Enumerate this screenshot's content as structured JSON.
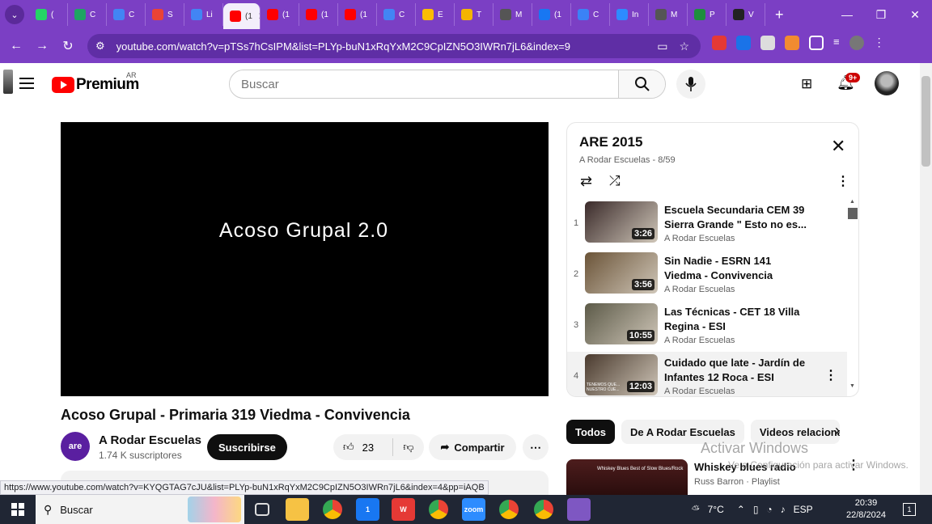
{
  "browser": {
    "tabs": [
      {
        "label": "(",
        "color": "#25d366"
      },
      {
        "label": "C",
        "color": "#1fa463"
      },
      {
        "label": "C",
        "color": "#4285f4"
      },
      {
        "label": "S",
        "color": "#ea4335"
      },
      {
        "label": "Li",
        "color": "#4285f4"
      },
      {
        "label": "(1",
        "color": "#ff0000",
        "active": true
      },
      {
        "label": "(1",
        "color": "#ff0000"
      },
      {
        "label": "(1",
        "color": "#ff0000"
      },
      {
        "label": "(1",
        "color": "#ff0000"
      },
      {
        "label": "C",
        "color": "#4285f4"
      },
      {
        "label": "E",
        "color": "#fbbc04"
      },
      {
        "label": "T",
        "color": "#f4b400"
      },
      {
        "label": "M",
        "color": "#555555"
      },
      {
        "label": "(1",
        "color": "#1877f2"
      },
      {
        "label": "C",
        "color": "#3b82f6"
      },
      {
        "label": "In",
        "color": "#2d8cff"
      },
      {
        "label": "M",
        "color": "#555555"
      },
      {
        "label": "P",
        "color": "#1e8e3e"
      },
      {
        "label": "V",
        "color": "#222222"
      }
    ],
    "url": "youtube.com/watch?v=pTSs7hCsIPM&list=PLYp-buN1xRqYxM2C9CpIZN5O3IWRn7jL6&index=9",
    "status_url": "https://www.youtube.com/watch?v=KYQGTAG7cJU&list=PLYp-buN1xRqYxM2C9CpIZN5O3IWRn7jL6&index=4&pp=iAQB"
  },
  "youtube": {
    "logo_text": "Premium",
    "country": "AR",
    "search_placeholder": "Buscar",
    "notifications_badge": "9+",
    "video": {
      "overlay_text": "Acoso Grupal 2.0",
      "title": "Acoso Grupal - Primaria 319 Viedma - Convivencia",
      "channel": "A Rodar Escuelas",
      "subscribers": "1.74 K suscriptores",
      "channel_avatar_text": "are",
      "subscribe_label": "Suscribirse",
      "likes": "23",
      "share_label": "Compartir"
    },
    "playlist": {
      "title": "ARE 2015",
      "subtitle": "A Rodar Escuelas - 8/59",
      "items": [
        {
          "index": "1",
          "title": "Escuela Secundaria CEM 39 Sierra Grande \" Esto no es...",
          "channel": "A Rodar Escuelas",
          "duration": "3:26",
          "thumb": "#3a2a2a"
        },
        {
          "index": "2",
          "title": "Sin Nadie - ESRN 141 Viedma - Convivencia",
          "channel": "A Rodar Escuelas",
          "duration": "3:56",
          "thumb": "#6b5438"
        },
        {
          "index": "3",
          "title": "Las Técnicas - CET 18 Villa Regina - ESI",
          "channel": "A Rodar Escuelas",
          "duration": "10:55",
          "thumb": "#5c5a48"
        },
        {
          "index": "4",
          "title": "Cuidado que late - Jardín de Infantes 12 Roca - ESI",
          "channel": "A Rodar Escuelas",
          "duration": "12:03",
          "thumb": "#4a3a2e",
          "overlay": "TENEMOS QUE... NUESTRO CUE..."
        }
      ]
    },
    "chips": [
      "Todos",
      "De A Rodar Escuelas",
      "Videos relaciona"
    ],
    "recommendation": {
      "title": "Whiskey blues radio",
      "subtitle": "Russ Barron · Playlist",
      "thumb_text": "Whiskey Blues Best of Slow Blues/Rock"
    },
    "watermark": {
      "line1": "Activar Windows",
      "line2": "Ve a Configuración para activar Windows."
    }
  },
  "taskbar": {
    "search_placeholder": "Buscar",
    "weather": "7°C",
    "language": "ESP",
    "time": "20:39",
    "date": "22/8/2024",
    "notifications": "1",
    "apps": [
      {
        "name": "task-view",
        "color": "transparent",
        "label": ""
      },
      {
        "name": "file-explorer",
        "color": "#f6c244",
        "label": ""
      },
      {
        "name": "chrome",
        "color": "#e0e0e0",
        "label": ""
      },
      {
        "name": "messenger",
        "color": "#1877f2",
        "label": "1"
      },
      {
        "name": "wps",
        "color": "#e53935",
        "label": "W"
      },
      {
        "name": "chrome-2",
        "color": "#e0e0e0",
        "label": ""
      },
      {
        "name": "zoom",
        "color": "#2d8cff",
        "label": "zoom"
      },
      {
        "name": "chrome-3",
        "color": "#e0e0e0",
        "label": ""
      },
      {
        "name": "chrome-4",
        "color": "#e0e0e0",
        "label": ""
      },
      {
        "name": "paint",
        "color": "#7e57c2",
        "label": ""
      }
    ]
  }
}
